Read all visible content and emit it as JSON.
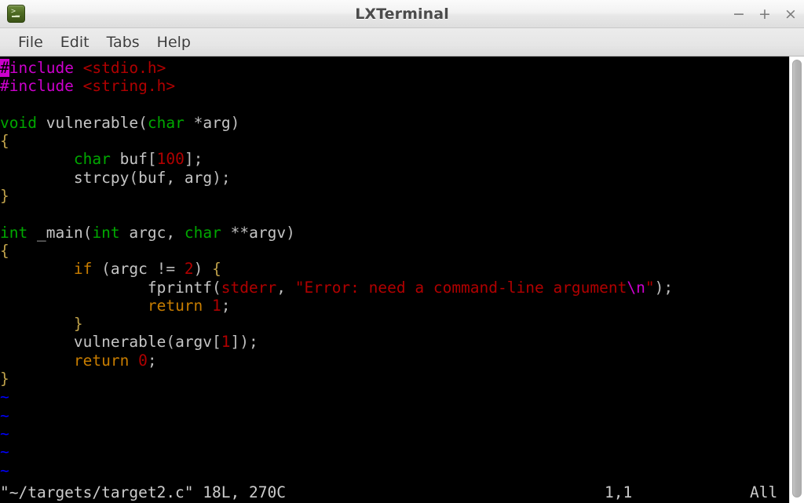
{
  "window": {
    "title": "LXTerminal",
    "icon": "terminal-icon",
    "buttons": {
      "minimize": "−",
      "maximize": "+",
      "close": "×"
    }
  },
  "menubar": {
    "items": [
      {
        "label": "File"
      },
      {
        "label": "Edit"
      },
      {
        "label": "Tabs"
      },
      {
        "label": "Help"
      }
    ]
  },
  "editor": {
    "application": "vim",
    "filename": "~/targets/target2.c",
    "cursor_char": "#",
    "lines": [
      {
        "id": "l1",
        "text": "#include <stdio.h>"
      },
      {
        "id": "l2",
        "text": "#include <string.h>"
      },
      {
        "id": "l3",
        "text": ""
      },
      {
        "id": "l4",
        "text": "void vulnerable(char *arg)"
      },
      {
        "id": "l5",
        "text": "{"
      },
      {
        "id": "l6",
        "text": "        char buf[100];"
      },
      {
        "id": "l7",
        "text": "        strcpy(buf, arg);"
      },
      {
        "id": "l8",
        "text": "}"
      },
      {
        "id": "l9",
        "text": ""
      },
      {
        "id": "l10",
        "text": "int _main(int argc, char **argv)"
      },
      {
        "id": "l11",
        "text": "{"
      },
      {
        "id": "l12",
        "text": "        if (argc != 2) {"
      },
      {
        "id": "l13",
        "text": "                fprintf(stderr, \"Error: need a command-line argument\\n\");"
      },
      {
        "id": "l14",
        "text": "                return 1;"
      },
      {
        "id": "l15",
        "text": "        }"
      },
      {
        "id": "l16",
        "text": "        vulnerable(argv[1]);"
      },
      {
        "id": "l17",
        "text": "        return 0;"
      },
      {
        "id": "l18",
        "text": "}"
      }
    ],
    "filler_lines": [
      "~",
      "~",
      "~",
      "~",
      "~"
    ],
    "statusline": {
      "file_info": "\"~/targets/target2.c\" 18L, 270C",
      "position": "1,1",
      "view": "All"
    }
  },
  "colors": {
    "terminal_background": "#000000",
    "terminal_foreground": "#cccccc",
    "preprocessor": "#cd00cd",
    "string": "#b00000",
    "type": "#00a800",
    "number": "#b00000",
    "statement": "#c87d00",
    "nontext": "#0000ff",
    "titlebar": "#f0f0f0",
    "cursor": "#cd00cd"
  },
  "scrollbar": {
    "orientation": "vertical"
  }
}
